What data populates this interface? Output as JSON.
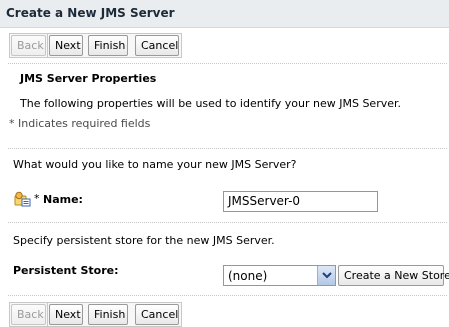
{
  "title": "Create a New JMS Server",
  "nav_top": {
    "back": "Back",
    "next": "Next",
    "finish": "Finish",
    "cancel": "Cancel"
  },
  "section": {
    "heading": "JMS Server Properties",
    "description": "The following properties will be used to identify your new JMS Server.",
    "required_note": "* Indicates required fields"
  },
  "name_prompt": "What would you like to name your new JMS Server?",
  "name_field": {
    "required_marker": "*",
    "label": "Name:",
    "value": "JMSServer-0"
  },
  "store_prompt": "Specify persistent store for the new JMS Server.",
  "store_field": {
    "label": "Persistent Store:",
    "selected": "(none)",
    "create_button": "Create a New Store"
  },
  "nav_bottom": {
    "back": "Back",
    "next": "Next",
    "finish": "Finish",
    "cancel": "Cancel"
  },
  "colors": {
    "title_bg": "#eaedf0",
    "input_border": "#7f9db9",
    "disabled_text": "#9a9a9a"
  }
}
